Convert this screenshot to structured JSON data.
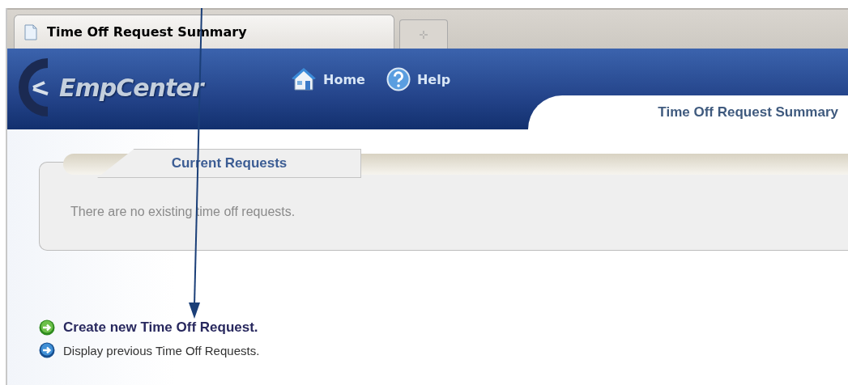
{
  "browser_tabs": [
    {
      "title": "Time Off Request Summary",
      "selected": true
    }
  ],
  "header": {
    "logo": "EmpCenter",
    "nav": [
      {
        "label": "Home",
        "kind": "home"
      },
      {
        "label": "Help",
        "kind": "help"
      }
    ],
    "page_tab": "Time Off Request Summary"
  },
  "panel": {
    "title": "Current Requests",
    "message": "There are no existing time off requests."
  },
  "actions": [
    {
      "label": "Create new Time Off Request.",
      "kind": "create"
    },
    {
      "label": "Display previous Time Off Requests.",
      "kind": "display"
    }
  ]
}
